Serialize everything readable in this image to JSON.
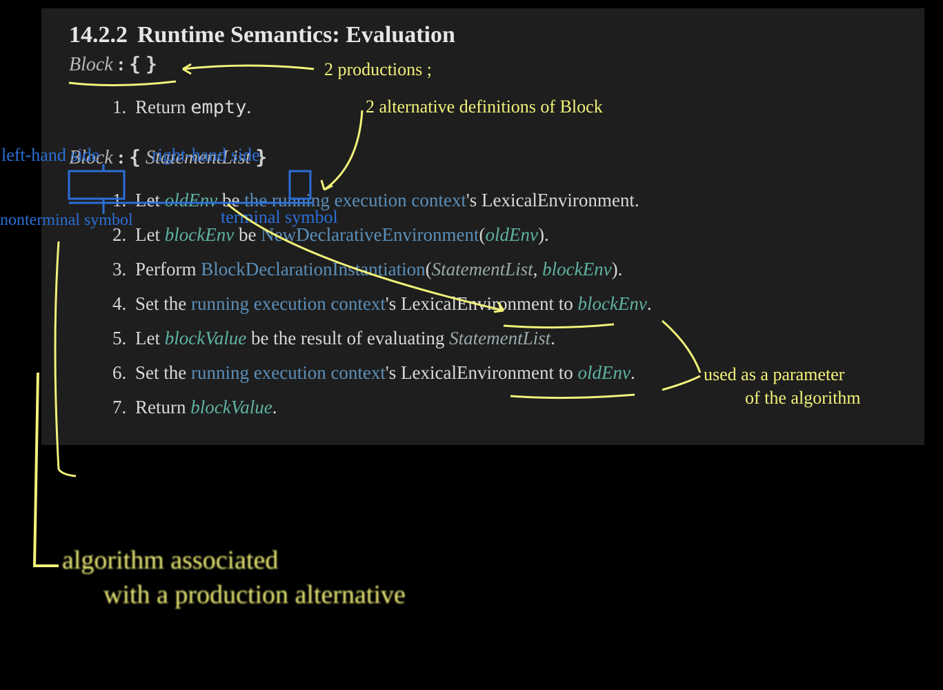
{
  "section": {
    "number": "14.2.2",
    "title": "Runtime Semantics: Evaluation"
  },
  "prod1": {
    "lhs": "Block",
    "colon": ":",
    "rhs_open": "{",
    "rhs_close": "}"
  },
  "alg1": {
    "step1_a": "Return ",
    "step1_b": "empty",
    "step1_c": "."
  },
  "prod2": {
    "lhs": "Block",
    "colon": ":",
    "rhs_open": "{",
    "rhs_mid": "StatementList",
    "rhs_close": "}"
  },
  "alg2": {
    "s1_a": "Let ",
    "s1_b": "oldEnv",
    "s1_c": " be ",
    "s1_d": "the running execution context",
    "s1_e": "'s LexicalEnvironment.",
    "s2_a": "Let ",
    "s2_b": "blockEnv",
    "s2_c": " be ",
    "s2_d": "NewDeclarativeEnvironment",
    "s2_e": "(",
    "s2_f": "oldEnv",
    "s2_g": ").",
    "s3_a": "Perform ",
    "s3_b": "BlockDeclarationInstantiation",
    "s3_c": "(",
    "s3_d": "StatementList",
    "s3_e": ", ",
    "s3_f": "blockEnv",
    "s3_g": ").",
    "s4_a": "Set the ",
    "s4_b": "running execution context",
    "s4_c": "'s LexicalEnvironment to ",
    "s4_d": "blockEnv",
    "s4_e": ".",
    "s5_a": "Let ",
    "s5_b": "blockValue",
    "s5_c": " be the result of evaluating ",
    "s5_d": "StatementList",
    "s5_e": ".",
    "s6_a": "Set the ",
    "s6_b": "running execution context",
    "s6_c": "'s LexicalEnvironment to ",
    "s6_d": "oldEnv",
    "s6_e": ".",
    "s7_a": "Return ",
    "s7_b": "blockValue",
    "s7_c": "."
  },
  "ann": {
    "two_prod": "2 productions ;",
    "two_alt": "2 alternative definitions of Block",
    "lhs": "left-hand side",
    "rhs": "right-hand side",
    "nonterm": "nonterminal symbol",
    "term": "terminal symbol",
    "used_param1": "used as a parameter",
    "used_param2": "of the algorithm",
    "algo_assoc1": "algorithm associated",
    "algo_assoc2": "with a production alternative"
  }
}
